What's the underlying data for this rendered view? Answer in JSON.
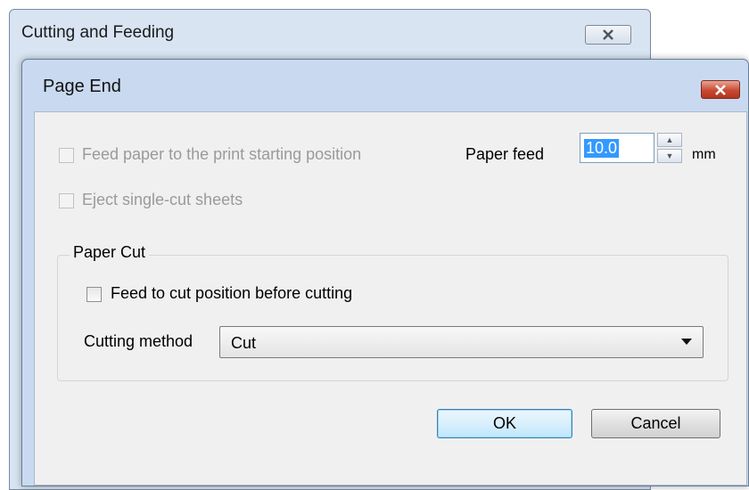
{
  "parent_window": {
    "title": "Cutting and Feeding"
  },
  "dialog": {
    "title": "Page End",
    "feed_to_start_label": "Feed paper to the print starting position",
    "eject_single_cut_label": "Eject single-cut sheets",
    "paper_feed_label": "Paper feed",
    "paper_feed_value": "10.0",
    "paper_feed_unit": "mm",
    "paper_cut": {
      "group_title": "Paper Cut",
      "feed_before_cut_label": "Feed to cut position before cutting",
      "cutting_method_label": "Cutting method",
      "cutting_method_value": "Cut"
    },
    "ok_label": "OK",
    "cancel_label": "Cancel"
  }
}
